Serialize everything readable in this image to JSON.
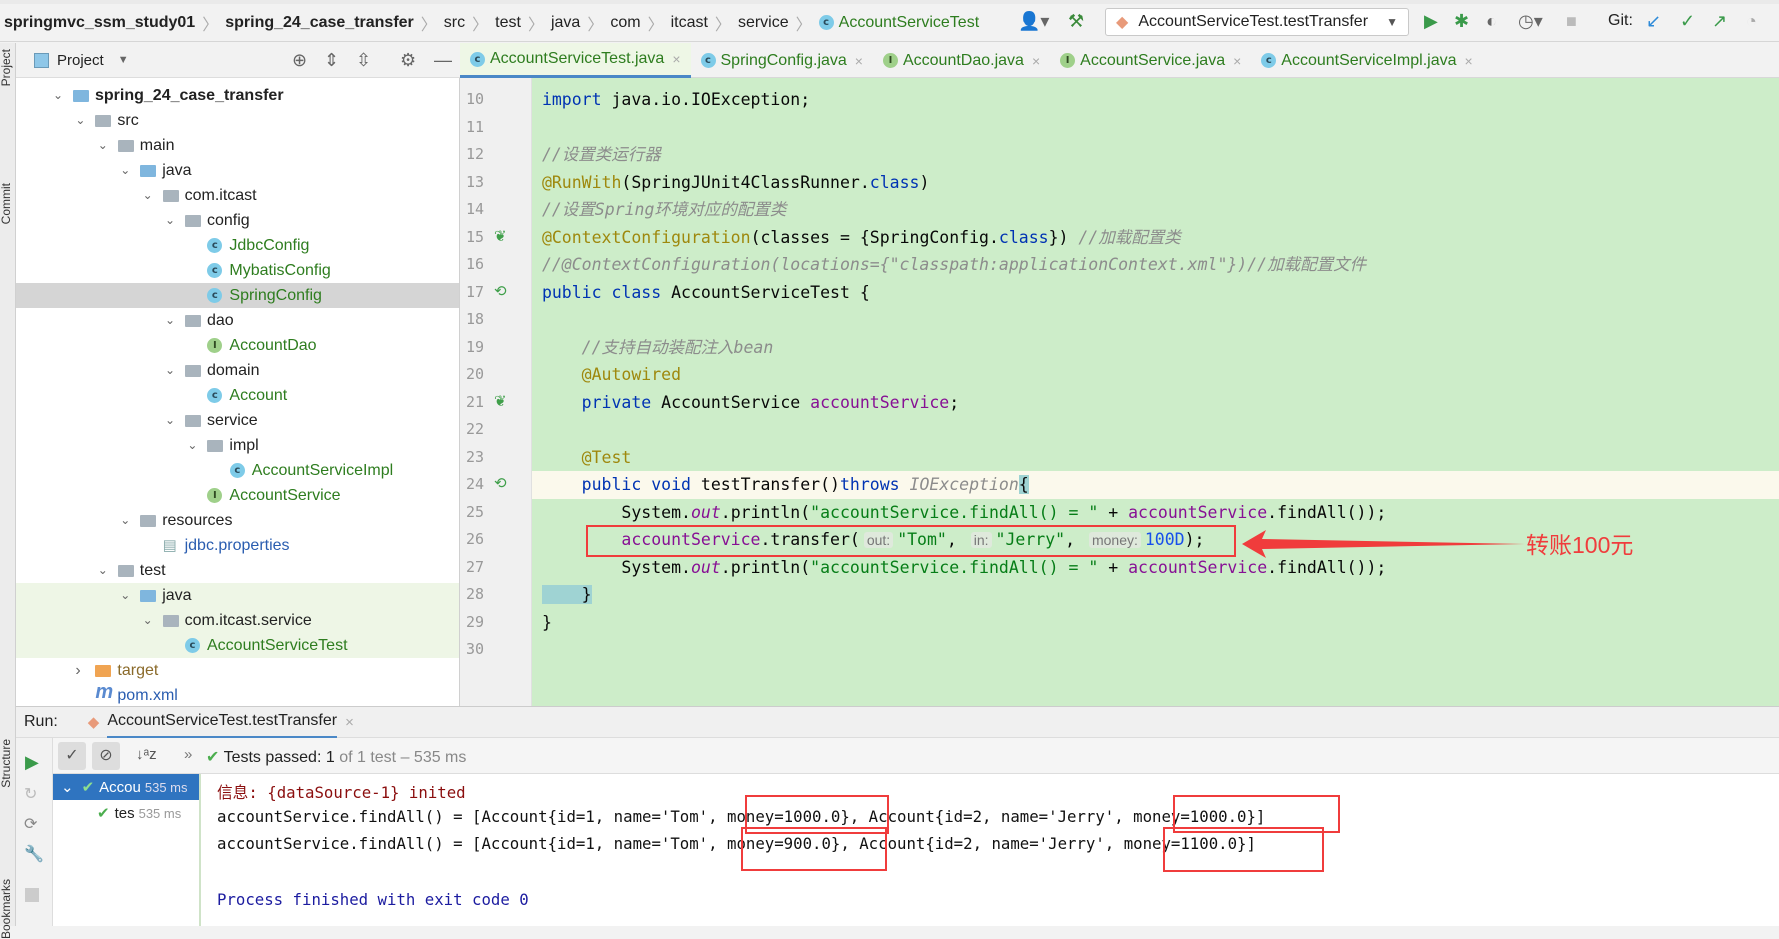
{
  "breadcrumb": {
    "items": [
      "springmvc_ssm_study01",
      "spring_24_case_transfer",
      "src",
      "test",
      "java",
      "com",
      "itcast",
      "service",
      "AccountServiceTest"
    ]
  },
  "toolbar": {
    "run_config": "AccountServiceTest.testTransfer",
    "git_label": "Git:"
  },
  "project_panel": {
    "title": "Project"
  },
  "tree": [
    {
      "label": "spring_24_case_transfer",
      "depth": 0,
      "type": "module",
      "open": true,
      "bold": true
    },
    {
      "label": "src",
      "depth": 1,
      "type": "folder",
      "open": true
    },
    {
      "label": "main",
      "depth": 2,
      "type": "folder",
      "open": true
    },
    {
      "label": "java",
      "depth": 3,
      "type": "src",
      "open": true
    },
    {
      "label": "com.itcast",
      "depth": 4,
      "type": "folder",
      "open": true
    },
    {
      "label": "config",
      "depth": 5,
      "type": "folder",
      "open": true
    },
    {
      "label": "JdbcConfig",
      "depth": 6,
      "type": "class"
    },
    {
      "label": "MybatisConfig",
      "depth": 6,
      "type": "class"
    },
    {
      "label": "SpringConfig",
      "depth": 6,
      "type": "class",
      "selected": true
    },
    {
      "label": "dao",
      "depth": 5,
      "type": "folder",
      "open": true
    },
    {
      "label": "AccountDao",
      "depth": 6,
      "type": "interface"
    },
    {
      "label": "domain",
      "depth": 5,
      "type": "folder",
      "open": true
    },
    {
      "label": "Account",
      "depth": 6,
      "type": "class"
    },
    {
      "label": "service",
      "depth": 5,
      "type": "folder",
      "open": true
    },
    {
      "label": "impl",
      "depth": 6,
      "type": "folder",
      "open": true
    },
    {
      "label": "AccountServiceImpl",
      "depth": 7,
      "type": "class"
    },
    {
      "label": "AccountService",
      "depth": 6,
      "type": "interface"
    },
    {
      "label": "resources",
      "depth": 3,
      "type": "res",
      "open": true
    },
    {
      "label": "jdbc.properties",
      "depth": 4,
      "type": "props"
    },
    {
      "label": "test",
      "depth": 2,
      "type": "folder",
      "open": true
    },
    {
      "label": "java",
      "depth": 3,
      "type": "src",
      "open": true,
      "test": true
    },
    {
      "label": "com.itcast.service",
      "depth": 4,
      "type": "folder",
      "open": true,
      "test": true
    },
    {
      "label": "AccountServiceTest",
      "depth": 5,
      "type": "testclass",
      "test": true
    },
    {
      "label": "target",
      "depth": 1,
      "type": "target",
      "open": false
    },
    {
      "label": "pom.xml",
      "depth": 1,
      "type": "maven"
    }
  ],
  "tabs": [
    {
      "label": "AccountServiceTest.java",
      "icon": "c",
      "active": true
    },
    {
      "label": "SpringConfig.java",
      "icon": "c"
    },
    {
      "label": "AccountDao.java",
      "icon": "i"
    },
    {
      "label": "AccountService.java",
      "icon": "i"
    },
    {
      "label": "AccountServiceImpl.java",
      "icon": "c"
    }
  ],
  "code": [
    {
      "n": "10",
      "s": [
        [
          "kw",
          "import "
        ],
        [
          "pl",
          "java.io.IOException;"
        ]
      ]
    },
    {
      "n": "11",
      "s": []
    },
    {
      "n": "12",
      "s": [
        [
          "cmt",
          "//设置类运行器"
        ]
      ]
    },
    {
      "n": "13",
      "s": [
        [
          "ann",
          "@RunWith"
        ],
        [
          "pl",
          "(SpringJUnit4ClassRunner."
        ],
        [
          "kw",
          "class"
        ],
        [
          "pl",
          ")"
        ]
      ]
    },
    {
      "n": "14",
      "s": [
        [
          "cmt",
          "//设置Spring环境对应的配置类"
        ]
      ]
    },
    {
      "n": "15",
      "g": "spring-leaf",
      "s": [
        [
          "ann",
          "@ContextConfiguration"
        ],
        [
          "pl",
          "(classes = {SpringConfig."
        ],
        [
          "kw",
          "class"
        ],
        [
          "pl",
          "}) "
        ],
        [
          "cmt",
          "//加载配置类"
        ]
      ]
    },
    {
      "n": "16",
      "s": [
        [
          "cmt",
          "//@ContextConfiguration(locations={\"classpath:applicationContext.xml\"})//加载配置文件"
        ]
      ]
    },
    {
      "n": "17",
      "g": "run",
      "s": [
        [
          "kw",
          "public class "
        ],
        [
          "pl",
          "AccountServiceTest {"
        ]
      ]
    },
    {
      "n": "18",
      "s": []
    },
    {
      "n": "19",
      "s": [
        [
          "cmt",
          "    //支持自动装配注入bean"
        ]
      ]
    },
    {
      "n": "20",
      "s": [
        [
          "ann",
          "    @Autowired"
        ]
      ]
    },
    {
      "n": "21",
      "g": "bean",
      "s": [
        [
          "kw",
          "    private "
        ],
        [
          "pl",
          "AccountService "
        ],
        [
          "fld",
          "accountService"
        ],
        [
          "pl",
          ";"
        ]
      ]
    },
    {
      "n": "22",
      "s": []
    },
    {
      "n": "23",
      "s": [
        [
          "ann",
          "    @Test"
        ]
      ]
    },
    {
      "n": "24",
      "g": "run",
      "hl": true,
      "s": [
        [
          "kw",
          "    public void "
        ],
        [
          "pl",
          "testTransfer()"
        ],
        [
          "kw",
          "throws "
        ],
        [
          "cmt",
          "IOException"
        ],
        [
          "caret",
          "{"
        ]
      ]
    },
    {
      "n": "25",
      "s": [
        [
          "pl",
          "        System."
        ],
        [
          "st",
          "out"
        ],
        [
          "pl",
          ".println("
        ],
        [
          "str",
          "\"accountService.findAll() = \""
        ],
        [
          "pl",
          " + "
        ],
        [
          "fld",
          "accountService"
        ],
        [
          "pl",
          ".findAll());"
        ]
      ]
    },
    {
      "n": "26",
      "s": [
        [
          "fld",
          "        accountService"
        ],
        [
          "pl",
          ".transfer("
        ],
        [
          "hint",
          "out:"
        ],
        [
          "str",
          "\"Tom\""
        ],
        [
          "pl",
          ", "
        ],
        [
          "hint",
          "in:"
        ],
        [
          "str",
          "\"Jerry\""
        ],
        [
          "pl",
          ", "
        ],
        [
          "hint",
          "money:"
        ],
        [
          "num",
          "100D"
        ],
        [
          "pl",
          ");"
        ]
      ]
    },
    {
      "n": "27",
      "s": [
        [
          "pl",
          "        System."
        ],
        [
          "st",
          "out"
        ],
        [
          "pl",
          ".println("
        ],
        [
          "str",
          "\"accountService.findAll() = \""
        ],
        [
          "pl",
          " + "
        ],
        [
          "fld",
          "accountService"
        ],
        [
          "pl",
          ".findAll());"
        ]
      ]
    },
    {
      "n": "28",
      "s": [
        [
          "caret",
          "    }"
        ]
      ]
    },
    {
      "n": "29",
      "s": [
        [
          "pl",
          "}"
        ]
      ]
    },
    {
      "n": "30",
      "s": []
    }
  ],
  "annotation": {
    "label": "转账100元",
    "color": "#f03c3c"
  },
  "run": {
    "label": "Run:",
    "tab": "AccountServiceTest.testTransfer",
    "status_prefix": "Tests passed:",
    "status_count": "1",
    "status_rest": "of 1 test – 535 ms",
    "tree": [
      {
        "label": "Accou",
        "time": "535 ms"
      },
      {
        "label": "tes",
        "time": "535 ms"
      }
    ],
    "console": [
      {
        "kind": "err",
        "text": "信息: {dataSource-1} inited"
      },
      {
        "kind": "pl",
        "text": "accountService.findAll() = [Account{id=1, name='Tom', money=1000.0}, Account{id=2, name='Jerry', money=1000.0}]"
      },
      {
        "kind": "pl",
        "text": "accountService.findAll() = [Account{id=1, name='Tom', money=900.0}, Account{id=2, name='Jerry', money=1100.0}]"
      },
      {
        "kind": "pl",
        "text": ""
      },
      {
        "kind": "proc",
        "text": "Process finished with exit code 0"
      }
    ]
  },
  "side_labels": {
    "project": "Project",
    "commit": "Commit",
    "structure": "Structure",
    "bookmarks": "Bookmarks"
  }
}
